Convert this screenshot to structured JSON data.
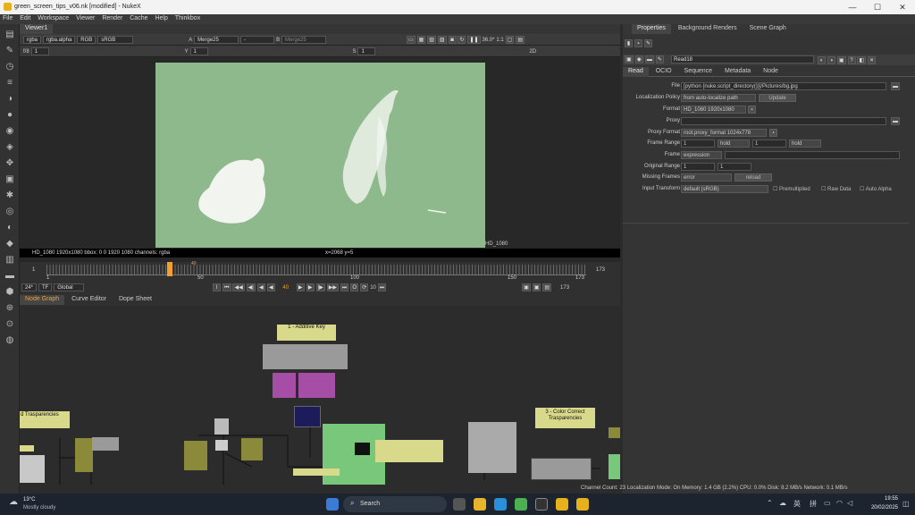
{
  "window": {
    "title": "green_screen_tips_v06.nk [modified] - NukeX",
    "minimize": "—",
    "maximize": "☐",
    "close": "✕"
  },
  "menu": [
    "File",
    "Edit",
    "Workspace",
    "Viewer",
    "Render",
    "Cache",
    "Help",
    "Thinkbox"
  ],
  "viewer": {
    "tab": "Viewer1",
    "channels": "rgba",
    "channel_alpha": "rgba.alpha",
    "display": "RGB",
    "colorspace": "sRGB",
    "a_label": "A",
    "a_input": "Merge25",
    "merge_op": "-",
    "b_label": "B",
    "b_input": "Merge25",
    "gain_label": "f/8",
    "gain_value": "1",
    "gamma_label": "Y",
    "gamma_value": "1",
    "zoom": "36.0*",
    "ratio": "1:1",
    "sample_label": "S",
    "sample_value": "1",
    "view_mode": "2D",
    "info_left": "HD_1080 1920x1080  bbox: 0 0 1920 1080 channels: rgba",
    "info_coords": "x=2068 y=5",
    "format_tag": "HD_1080",
    "fps": "24*",
    "tf": "TF",
    "global": "Global",
    "frame_current": "40",
    "frame_start": "1",
    "frame_end": "173",
    "ticks": [
      "1",
      "50",
      "100",
      "150",
      "173"
    ],
    "playhead": "40",
    "playhead_fraction": 0.229,
    "step": "10"
  },
  "properties": {
    "tabs": [
      "Properties",
      "Background Renders",
      "Scene Graph"
    ],
    "node_name": "Read18",
    "subtabs": [
      "Read",
      "OCIO",
      "Sequence",
      "Metadata",
      "Node"
    ],
    "rows": [
      {
        "label": "File",
        "value": "[python {nuke.script_directory()}]/Pictures/bg.jpg"
      },
      {
        "label": "Localization Policy",
        "value": "from auto-localize path",
        "button": "Update"
      },
      {
        "label": "Format",
        "value": "HD_1080 1920x1080"
      },
      {
        "label": "Proxy",
        "value": ""
      },
      {
        "label": "Proxy Format",
        "value": "root.proxy_format 1024x778"
      },
      {
        "label": "Frame Range",
        "value": "1",
        "mode1": "hold",
        "value2": "1",
        "mode2": "hold"
      },
      {
        "label": "Frame",
        "value": "expression"
      },
      {
        "label": "Original Range",
        "value": "1",
        "value2": "1"
      },
      {
        "label": "Missing Frames",
        "value": "error",
        "button": "reload"
      },
      {
        "label": "Input Transform",
        "value": "default (sRGB)"
      }
    ],
    "checkboxes": [
      "Premultiplied",
      "Raw Data",
      "Auto Alpha"
    ]
  },
  "nodegraph": {
    "tabs": [
      "Node Graph",
      "Curve Editor",
      "Dope Sheet"
    ],
    "sticky_notes": [
      "1 - Additive Key",
      "3 - Color Correct\nTrasparencies",
      "d Trasparencies"
    ]
  },
  "status": {
    "text": "Channel Count: 23  Localization Mode: On  Memory: 1.4 GB (2.2%)  CPU: 0.0%  Disk: 8.2 MB/s  Network: 0.1 MB/s"
  },
  "taskbar": {
    "temp": "13°C",
    "weather": "Mostly cloudy",
    "search": "Search",
    "lang": "英",
    "ime": "拼",
    "time": "19:55",
    "date": "20/02/2025"
  },
  "colors": {
    "accent_orange": "#f0a030",
    "viewer_green": "#8eb98c"
  }
}
